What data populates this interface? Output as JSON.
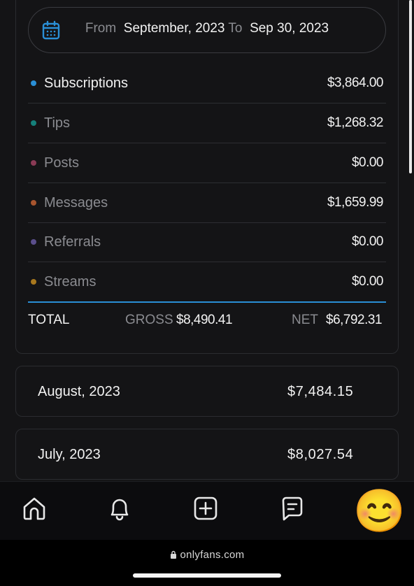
{
  "date_range": {
    "from_label": "From",
    "from_value": "September, 2023",
    "to_label": "To",
    "to_value": "Sep 30, 2023"
  },
  "categories": [
    {
      "label": "Subscriptions",
      "amount": "$3,864.00",
      "color": "#2a8fd6",
      "active": true
    },
    {
      "label": "Tips",
      "amount": "$1,268.32",
      "color": "#15807a",
      "active": false
    },
    {
      "label": "Posts",
      "amount": "$0.00",
      "color": "#8a3a55",
      "active": false
    },
    {
      "label": "Messages",
      "amount": "$1,659.99",
      "color": "#a8552e",
      "active": false
    },
    {
      "label": "Referrals",
      "amount": "$0.00",
      "color": "#5b4f8c",
      "active": false
    },
    {
      "label": "Streams",
      "amount": "$0.00",
      "color": "#a8781e",
      "active": false
    }
  ],
  "totals": {
    "total_label": "TOTAL",
    "gross_label": "GROSS",
    "gross_value": "$8,490.41",
    "net_label": "NET",
    "net_value": "$6,792.31"
  },
  "months": [
    {
      "label": "August, 2023",
      "value": "$7,484.15"
    },
    {
      "label": "July, 2023",
      "value": "$8,027.54"
    }
  ],
  "tabbar": {
    "icons": [
      "home-icon",
      "bell-icon",
      "add-post-icon",
      "messages-icon",
      "avatar"
    ],
    "avatar_emoji": "😊"
  },
  "browser": {
    "url": "onlyfans.com"
  },
  "colors": {
    "accent": "#2a8fd6",
    "background": "#141416",
    "muted_text": "#8a8b90"
  }
}
